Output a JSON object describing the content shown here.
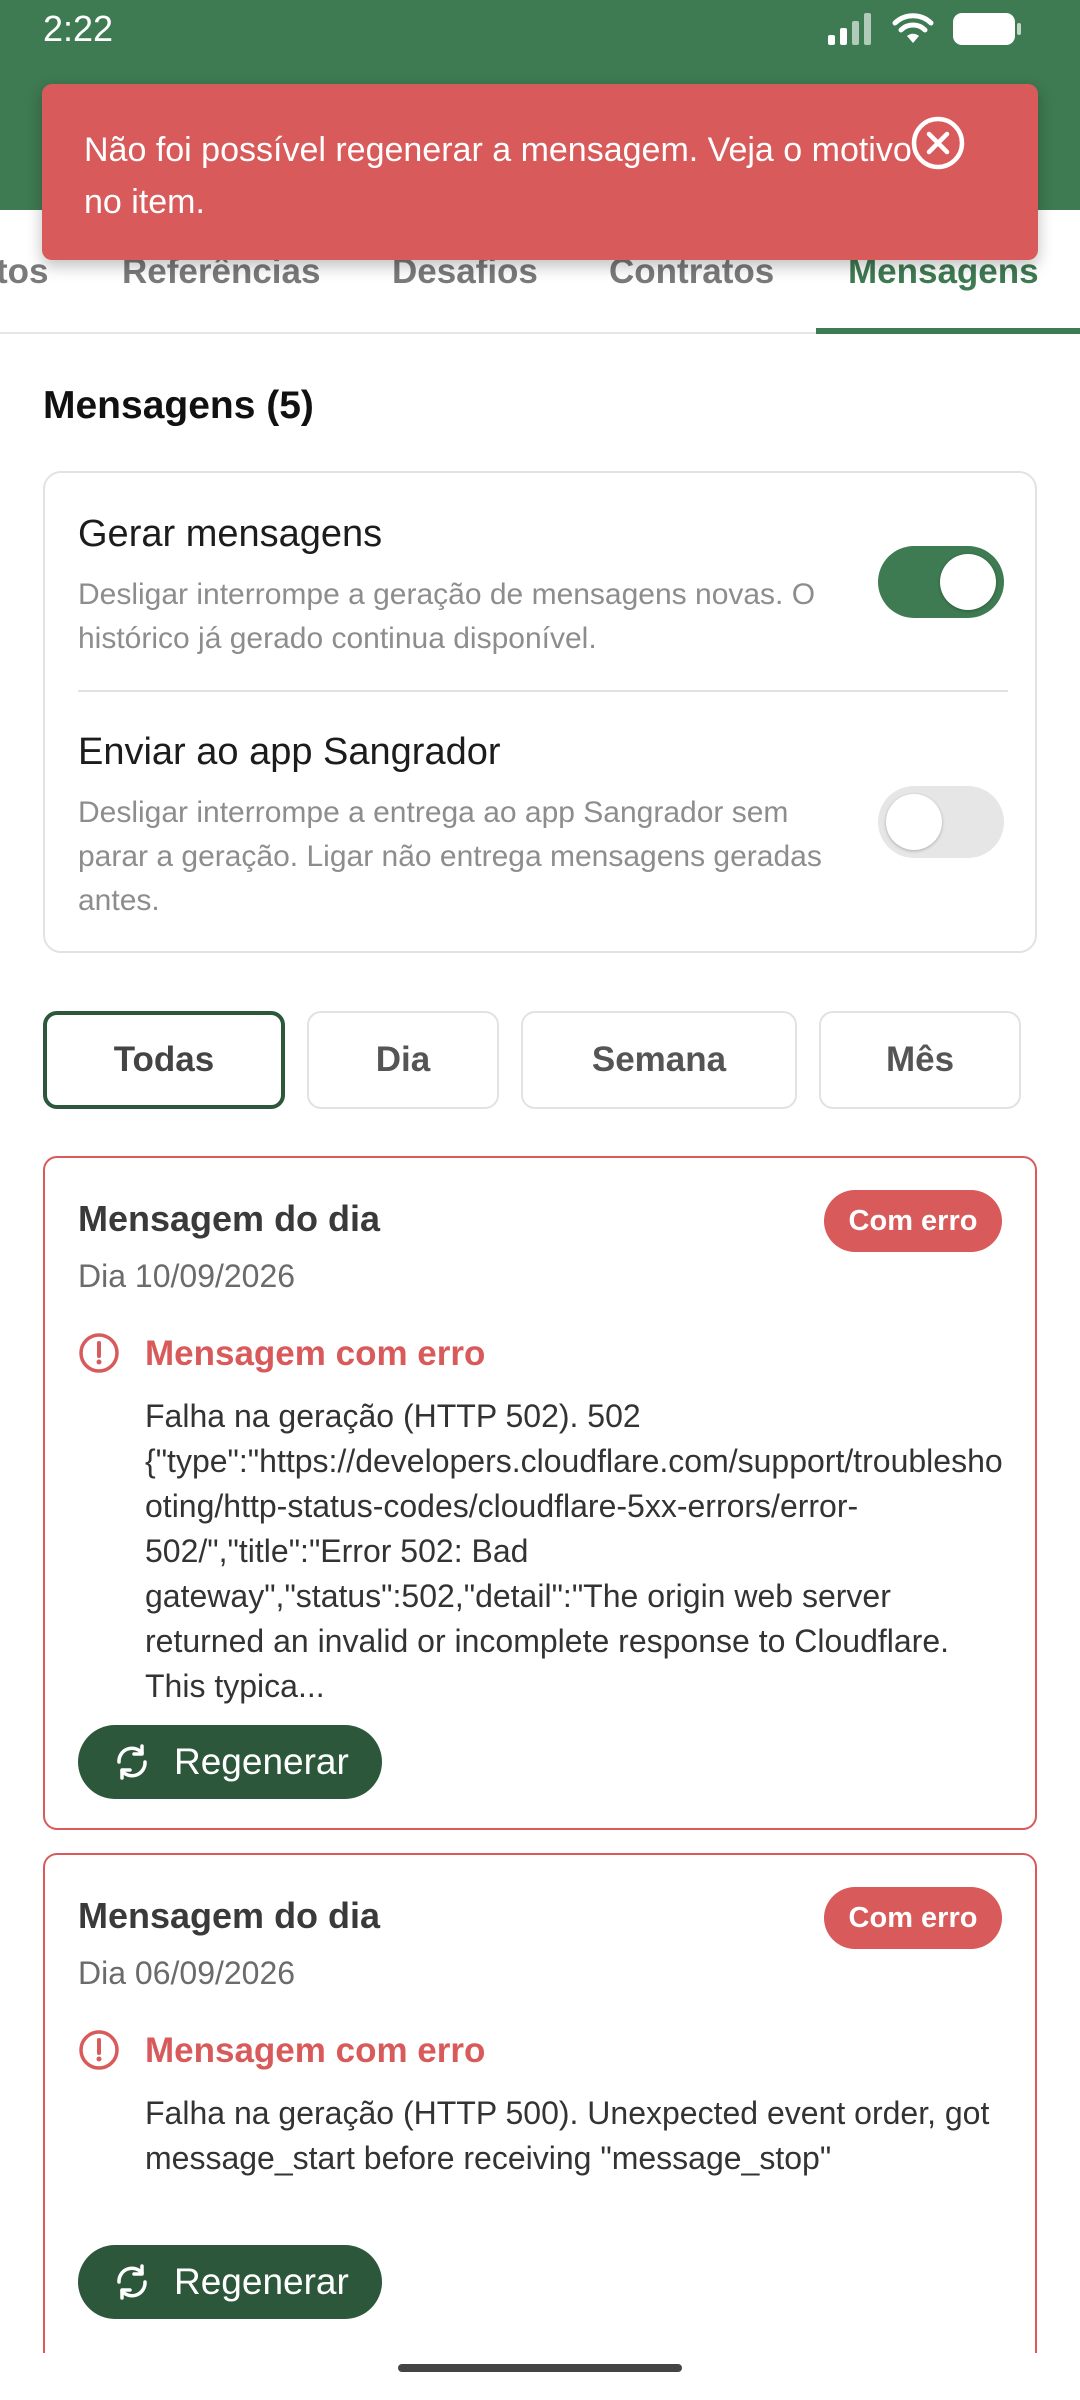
{
  "status_bar": {
    "time": "2:22"
  },
  "toast": {
    "message": "Não foi possível regenerar a mensagem. Veja o motivo no item.",
    "close_icon": "close-circle-icon"
  },
  "tabs": [
    {
      "label": "tos"
    },
    {
      "label": "Referências"
    },
    {
      "label": "Desafios"
    },
    {
      "label": "Contratos"
    },
    {
      "label": "Mensagens",
      "active": true
    }
  ],
  "section": {
    "title": "Mensagens (5)"
  },
  "settings": {
    "generate": {
      "title": "Gerar mensagens",
      "description": "Desligar interrompe a geração de mensagens novas. O histórico já gerado continua disponível.",
      "enabled": true
    },
    "send": {
      "title": "Enviar ao app Sangrador",
      "description": "Desligar interrompe a entrega ao app Sangrador sem parar a geração. Ligar não entrega mensagens geradas antes.",
      "enabled": false
    }
  },
  "filters": [
    {
      "label": "Todas",
      "active": true
    },
    {
      "label": "Dia"
    },
    {
      "label": "Semana"
    },
    {
      "label": "Mês"
    }
  ],
  "messages": [
    {
      "title": "Mensagem do dia",
      "date": "Dia 10/09/2026",
      "badge": "Com erro",
      "error_heading": "Mensagem com erro",
      "error_body": "Falha na geração (HTTP 502). 502 {\"type\":\"https://developers.cloudflare.com/support/troubleshooting/http-status-codes/cloudflare-5xx-errors/error-502/\",\"title\":\"Error 502: Bad gateway\",\"status\":502,\"detail\":\"The origin web server returned an invalid or incomplete response to Cloudflare. This typica...",
      "button": "Regenerar"
    },
    {
      "title": "Mensagem do dia",
      "date": "Dia 06/09/2026",
      "badge": "Com erro",
      "error_heading": "Mensagem com erro",
      "error_body": "Falha na geração (HTTP 500). Unexpected event order, got message_start before receiving \"message_stop\"",
      "button": "Regenerar"
    }
  ],
  "colors": {
    "primary": "#3e7a52",
    "primary_dark": "#2c573b",
    "error": "#d85a5a"
  }
}
